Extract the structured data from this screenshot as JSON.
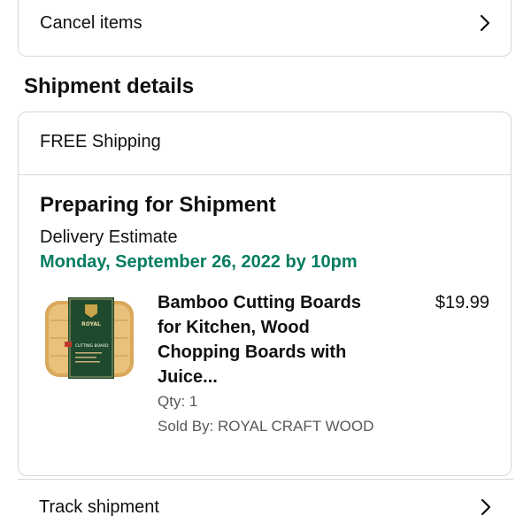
{
  "cancel": {
    "label": "Cancel items"
  },
  "shipment_section": {
    "title": "Shipment details",
    "shipping_type": "FREE Shipping",
    "status": "Preparing for Shipment",
    "delivery_label": "Delivery Estimate",
    "delivery_date": "Monday, September 26, 2022 by 10pm"
  },
  "product": {
    "title": "Bamboo Cutting Boards for Kitchen, Wood Chopping Boards with Juice...",
    "price": "$19.99",
    "qty": "Qty: 1",
    "sold_by": "Sold By: ROYAL CRAFT WOOD",
    "image_icon": "cutting-board-product-image",
    "package_brand": "ROYAL",
    "package_label": "CUTTING BOARD"
  },
  "track": {
    "label": "Track shipment"
  },
  "colors": {
    "delivery_green": "#067d62",
    "border": "#d5d9d9",
    "muted_text": "#565959"
  }
}
